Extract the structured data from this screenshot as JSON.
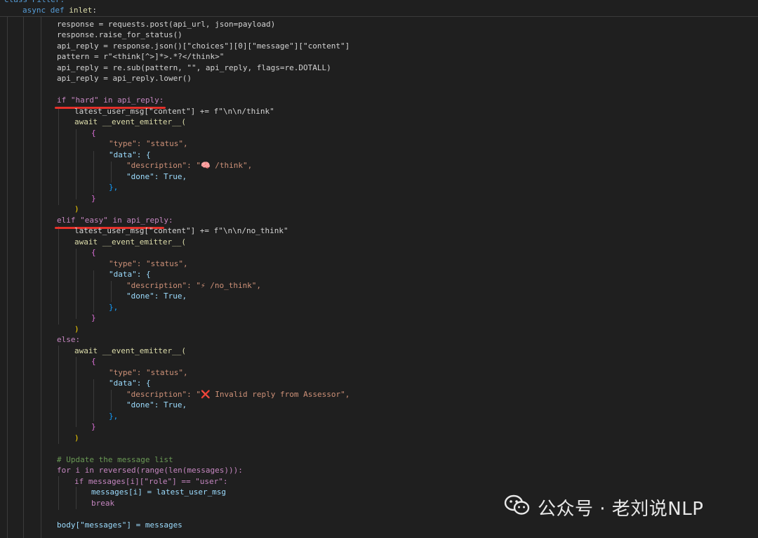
{
  "code": {
    "l0": "class Filter:",
    "l1a": "async",
    "l1b": "def",
    "l1c": "inlet",
    "lines": [
      "response = requests.post(api_url, json=payload)",
      "response.raise_for_status()",
      "api_reply = response.json()[\"choices\"][0][\"message\"][\"content\"]",
      "pattern = r\"<think[^>]*>.*?</think>\"",
      "api_reply = re.sub(pattern, \"\", api_reply, flags=re.DOTALL)",
      "api_reply = api_reply.lower()"
    ],
    "if_line": "if \"hard\" in api_reply:",
    "if_body": "latest_user_msg[\"content\"] += f\"\\n\\n/think\"",
    "elif_line": "elif \"easy\" in api_reply:",
    "elif_body": "latest_user_msg[\"content\"] += f\"\\n\\n/no_think\"",
    "else_line": "else:",
    "await_line": "await __event_emitter__(",
    "brace_open": "{",
    "type_line": "\"type\": \"status\",",
    "data_line": "\"data\": {",
    "desc_think": "\"description\": \"🧠 /think\",",
    "desc_nothink": "\"description\": \"⚡ /no_think\",",
    "desc_invalid": "\"description\": \"❌ Invalid reply from Assessor\",",
    "done_line": "\"done\": True,",
    "inner_close": "},",
    "brace_close": "}",
    "paren_close": ")",
    "comment": "# Update the message list",
    "for_line": "for i in reversed(range(len(messages))):",
    "if_role": "if messages[i][\"role\"] == \"user\":",
    "assign_msg": "messages[i] = latest_user_msg",
    "break_line": "break",
    "body_line": "body[\"messages\"] = messages"
  },
  "watermark": {
    "text": "公众号 · 老刘说NLP",
    "icon": "wechat-icon"
  },
  "colors": {
    "background": "#1f1f1f",
    "underline": "#e5312a"
  }
}
